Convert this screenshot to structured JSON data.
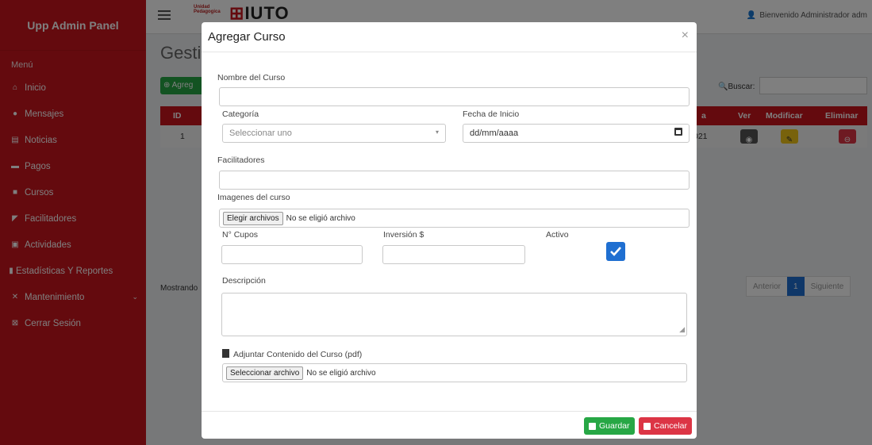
{
  "sidebar": {
    "brand": "Upp Admin Panel",
    "menu_title": "Menú",
    "items": [
      {
        "label": "Inicio",
        "icon": "home-icon"
      },
      {
        "label": "Mensajes",
        "icon": "chat-icon"
      },
      {
        "label": "Noticias",
        "icon": "newspaper-icon"
      },
      {
        "label": "Pagos",
        "icon": "money-icon"
      },
      {
        "label": "Cursos",
        "icon": "book-icon"
      },
      {
        "label": "Facilitadores",
        "icon": "bullhorn-icon"
      },
      {
        "label": "Actividades",
        "icon": "image-icon"
      },
      {
        "label": "Estadísticas Y Reportes",
        "icon": "file-icon"
      },
      {
        "label": "Mantenimiento",
        "icon": "tools-icon"
      },
      {
        "label": "Cerrar Sesión",
        "icon": "close-box-icon"
      }
    ]
  },
  "topbar": {
    "logo_small": "Unidad\nPedagogica",
    "logo_big": "IUTO",
    "user": "Bienvenido Administrador adm"
  },
  "background": {
    "page_title": "Gesti",
    "add_button": "Agreg",
    "search_label": "Buscar:",
    "headers": {
      "id": "ID",
      "a": "a",
      "ver": "Ver",
      "modificar": "Modificar",
      "eliminar": "Eliminar"
    },
    "row": {
      "id": "1",
      "partial": "021"
    },
    "showing": "Mostrando",
    "pager": {
      "prev": "Anterior",
      "page": "1",
      "next": "Siguiente"
    }
  },
  "modal": {
    "title": "Agregar Curso",
    "close": "×",
    "nombre_label": "Nombre del Curso",
    "categoria_label": "Categoría",
    "categoria_placeholder": "Seleccionar uno",
    "fecha_label": "Fecha de Inicio",
    "fecha_placeholder": "dd/mm/aaaa",
    "facilitadores_label": "Facilitadores",
    "imagenes_label": "Imagenes del curso",
    "imagenes_button": "Elegir archivos",
    "imagenes_status": "No se eligió archivo",
    "cupos_label": "N° Cupos",
    "inversion_label": "Inversión $",
    "activo_label": "Activo",
    "activo_checked": true,
    "descripcion_label": "Descripción",
    "pdf_label": "Adjuntar Contenido del Curso (pdf)",
    "pdf_button": "Seleccionar archivo",
    "pdf_status": "No se eligió archivo",
    "save_label": "Guardar",
    "cancel_label": "Cancelar"
  },
  "colors": {
    "brand_red": "#c8141c",
    "success": "#27a745",
    "danger": "#dc3545",
    "primary": "#1f6fd1",
    "warning": "#f0c419"
  }
}
